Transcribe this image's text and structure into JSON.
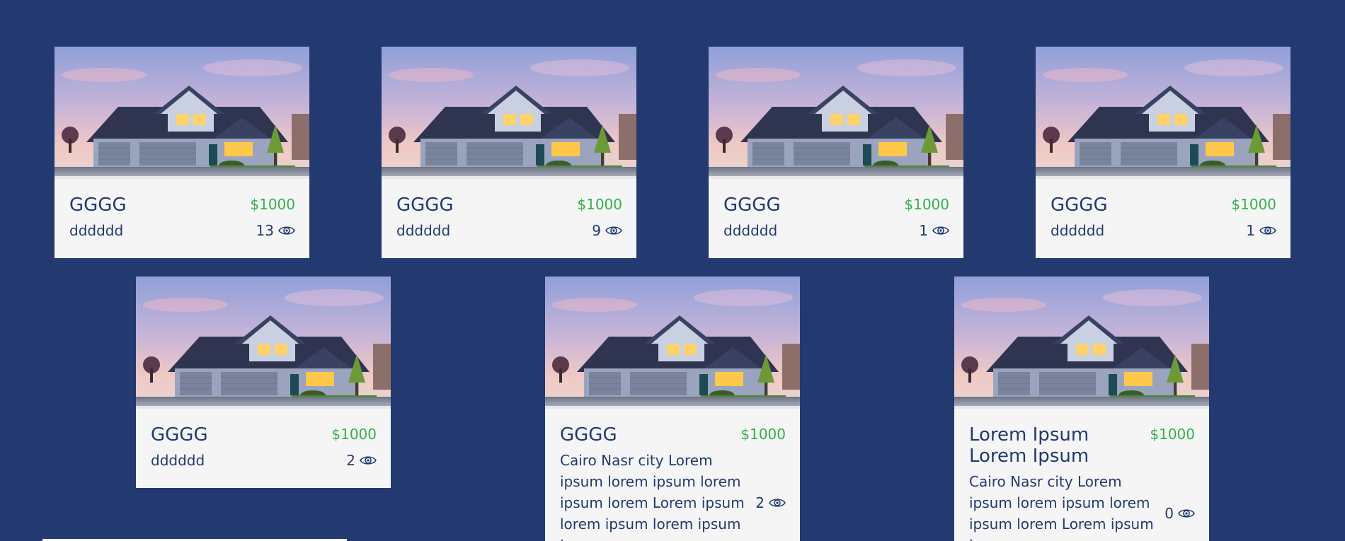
{
  "cards": [
    {
      "title": "GGGG",
      "price": "$1000",
      "description": "dddddd",
      "views": "13"
    },
    {
      "title": "GGGG",
      "price": "$1000",
      "description": "dddddd",
      "views": "9"
    },
    {
      "title": "GGGG",
      "price": "$1000",
      "description": "dddddd",
      "views": "1"
    },
    {
      "title": "GGGG",
      "price": "$1000",
      "description": "dddddd",
      "views": "1"
    },
    {
      "title": "GGGG",
      "price": "$1000",
      "description": "dddddd",
      "views": "2"
    },
    {
      "title": "GGGG",
      "price": "$1000",
      "description": "Cairo Nasr city Lorem ipsum lorem ipsum lorem ipsum lorem Lorem ipsum lorem ipsum lorem ipsum Lorem",
      "views": "2"
    },
    {
      "title": "Lorem Ipsum Lorem Ipsum",
      "price": "$1000",
      "description": "Cairo Nasr city Lorem ipsum lorem ipsum lorem ipsum lorem Lorem ipsum lorem",
      "views": "0"
    }
  ],
  "colors": {
    "background": "#223a70",
    "card": "#f5f5f5",
    "price": "#34b04a",
    "text": "#223a70"
  },
  "icons": {
    "house_photo": "house-photo",
    "views": "eye-icon"
  }
}
